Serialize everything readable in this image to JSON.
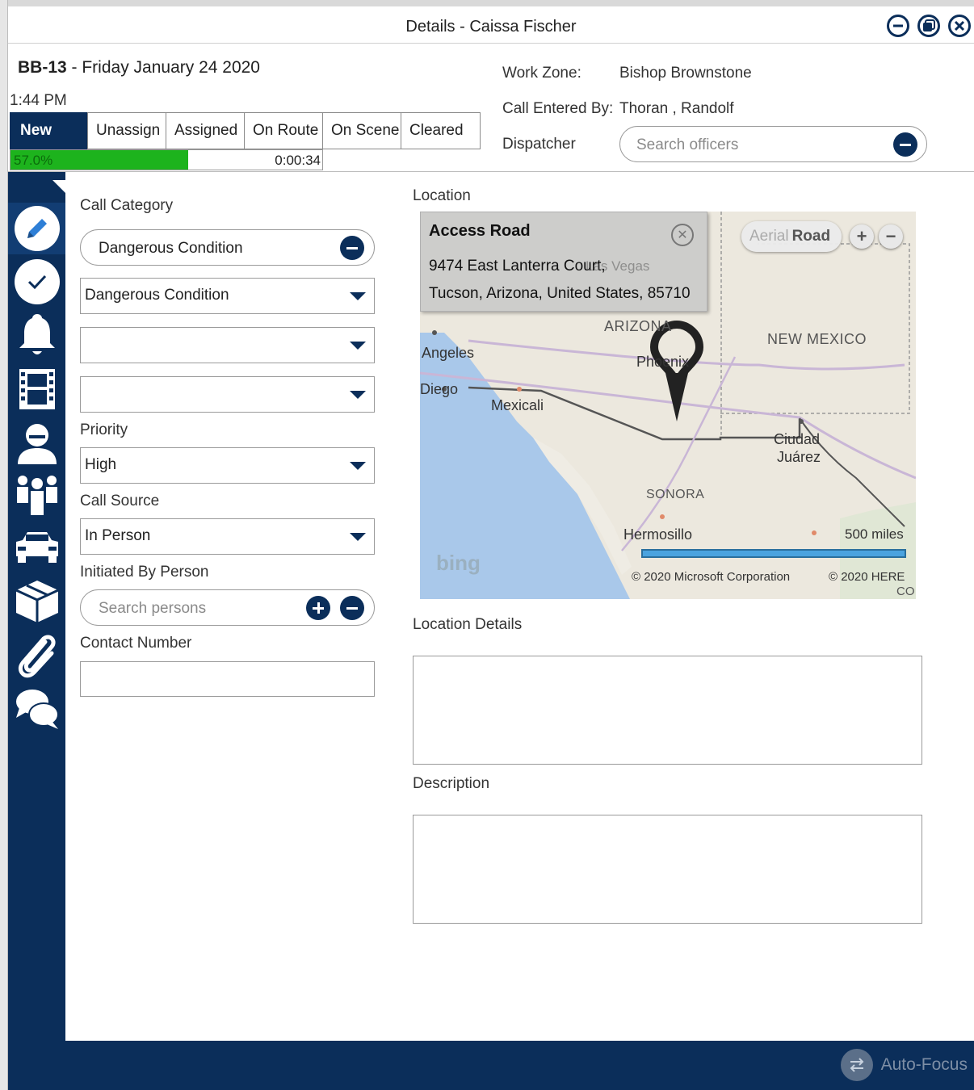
{
  "window": {
    "title": "Details - Caissa Fischer",
    "controls": [
      "minimize-icon",
      "restore-icon",
      "close-icon"
    ]
  },
  "header": {
    "incident_id": "BB-13",
    "date_text": " - Friday January 24 2020",
    "time": "1:44 PM",
    "statuses": [
      "New",
      "Unassign",
      "Assigned",
      "On Route",
      "On Scene",
      "Cleared"
    ],
    "active_status": "New",
    "progress_percent": 57.0,
    "progress_label": "57.0%",
    "elapsed": "0:00:34",
    "work_zone_label": "Work Zone:",
    "work_zone_value": "Bishop Brownstone",
    "call_entered_label": "Call Entered By:",
    "call_entered_value": "Thoran , Randolf",
    "dispatcher_label": "Dispatcher",
    "dispatcher_placeholder": "Search officers"
  },
  "sidebar": {
    "icons": [
      "pencil-icon",
      "checkmark-icon",
      "bell-icon",
      "film-icon",
      "officer-icon",
      "people-icon",
      "car-icon",
      "box-icon",
      "paperclip-icon",
      "chat-icon"
    ],
    "active": "pencil-icon"
  },
  "form": {
    "call_category_label": "Call Category",
    "call_category_pill": "Dangerous Condition",
    "call_category_select": "Dangerous Condition",
    "sub_select_1": "",
    "sub_select_2": "",
    "priority_label": "Priority",
    "priority_value": "High",
    "call_source_label": "Call Source",
    "call_source_value": "In Person",
    "initiated_by_label": "Initiated By Person",
    "initiated_by_placeholder": "Search persons",
    "contact_number_label": "Contact Number",
    "contact_number_value": ""
  },
  "location": {
    "label": "Location",
    "popup_title": "Access Road",
    "popup_line1": "9474 East Lanterra Court,",
    "popup_line2": "Tucson, Arizona, United States, 85710",
    "map_type_aerial": "Aerial",
    "map_type_road": "Road",
    "map_labels": {
      "arizona": "ARIZONA",
      "new_mexico": "NEW MEXICO",
      "angeles": "Angeles",
      "diego": "Diego",
      "mexicali": "Mexicali",
      "phoenix": "Phoenix",
      "ciudad": "Ciudad",
      "juarez": "Juárez",
      "sonora": "SONORA",
      "hermosillo": "Hermosillo",
      "las_vegas": "Las Vegas"
    },
    "scale_label": "500 miles",
    "copyright_ms": "© 2020 Microsoft Corporation",
    "copyright_here": "© 2020 HERE",
    "copyright_co": "CO",
    "bing": "bing",
    "details_label": "Location Details",
    "details_value": "",
    "description_label": "Description",
    "description_value": ""
  },
  "footer": {
    "auto_focus_label": "Auto-Focus"
  },
  "colors": {
    "navy": "#0b2e5a",
    "progress_green": "#1db31d",
    "scale_blue": "#4aa3df"
  }
}
